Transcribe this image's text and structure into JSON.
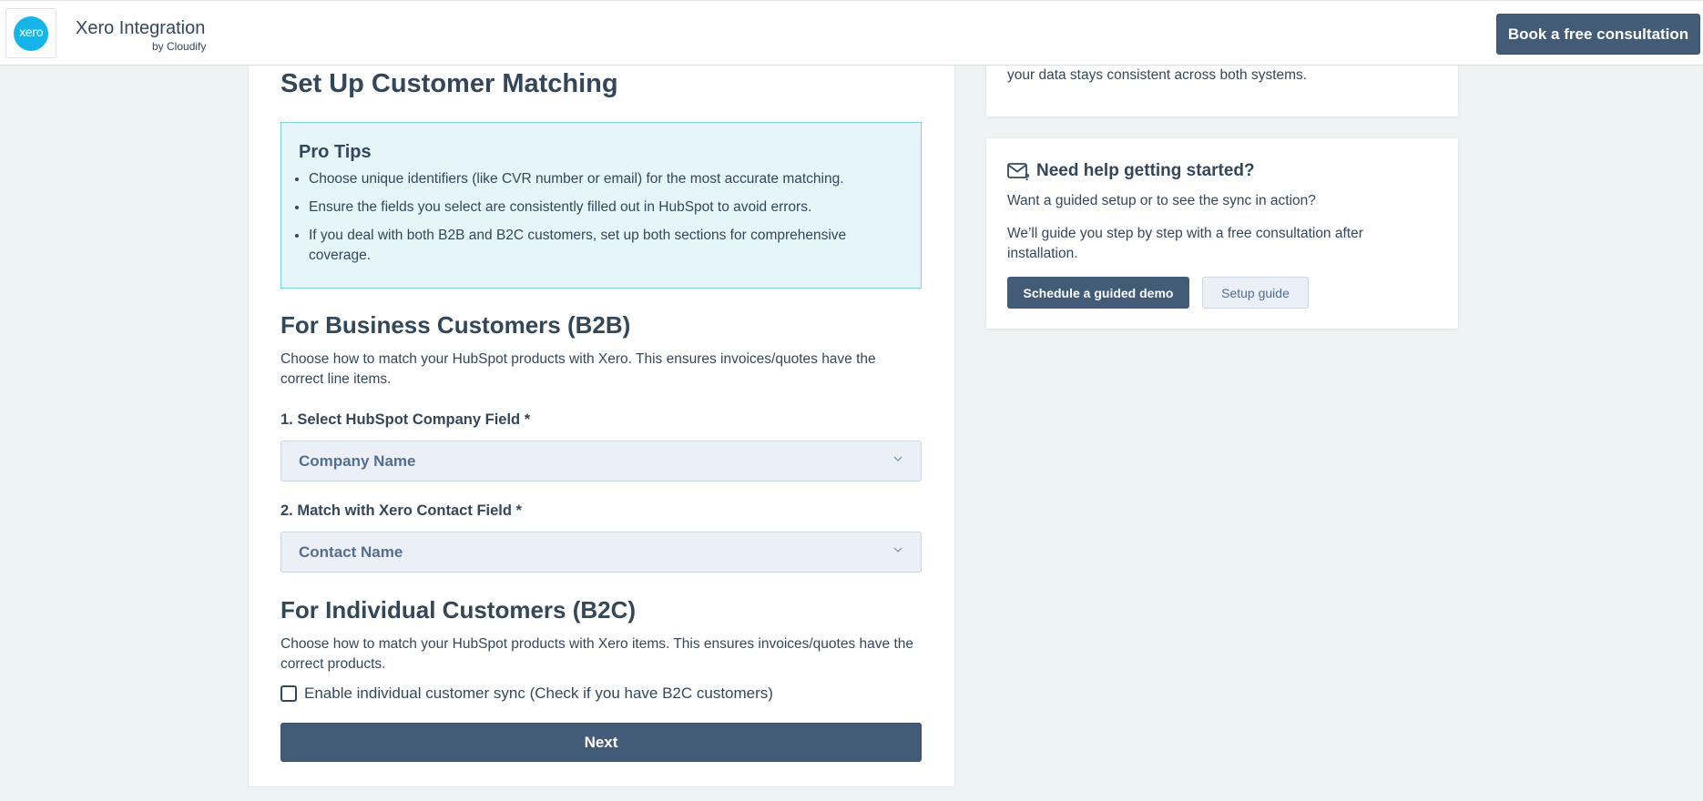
{
  "header": {
    "logo_text": "xero",
    "app_title": "Xero Integration",
    "app_subtitle": "by Cloudify",
    "consult_button": "Book a free consultation"
  },
  "main": {
    "title": "Set Up Customer Matching",
    "tips": {
      "title": "Pro Tips",
      "items": [
        "Choose unique identifiers (like CVR number or email) for the most accurate matching.",
        "Ensure the fields you select are consistently filled out in HubSpot to avoid errors.",
        "If you deal with both B2B and B2C customers, set up both sections for comprehensive coverage."
      ]
    },
    "b2b": {
      "heading": "For Business Customers (B2B)",
      "description": "Choose how to match your HubSpot products with Xero. This ensures invoices/quotes have the correct line items.",
      "field1_label": "1. Select HubSpot Company Field *",
      "field1_value": "Company Name",
      "field2_label": "2. Match with Xero Contact Field *",
      "field2_value": "Contact Name"
    },
    "b2c": {
      "heading": "For Individual Customers (B2C)",
      "description": "Choose how to match your HubSpot products with Xero items. This ensures invoices/quotes have the correct products.",
      "checkbox_label": "Enable individual customer sync (Check if you have B2C customers)",
      "checkbox_checked": false
    },
    "next_button": "Next"
  },
  "sidebar": {
    "top_card_text": "your data stays consistent across both systems.",
    "help": {
      "icon": "mail-question-icon",
      "title": "Need help getting started?",
      "question": "Want a guided setup or to see the sync in action?",
      "paragraph": "We’ll guide you step by step with a free consultation after installation.",
      "demo_button": "Schedule a guided demo",
      "guide_button": "Setup guide"
    }
  },
  "colors": {
    "primary": "#425b76",
    "text": "#33475b",
    "tips_bg": "#e5f5f8",
    "tips_border": "#7fd1de",
    "xero_blue": "#13b5ea",
    "page_bg": "#eef4f3"
  }
}
